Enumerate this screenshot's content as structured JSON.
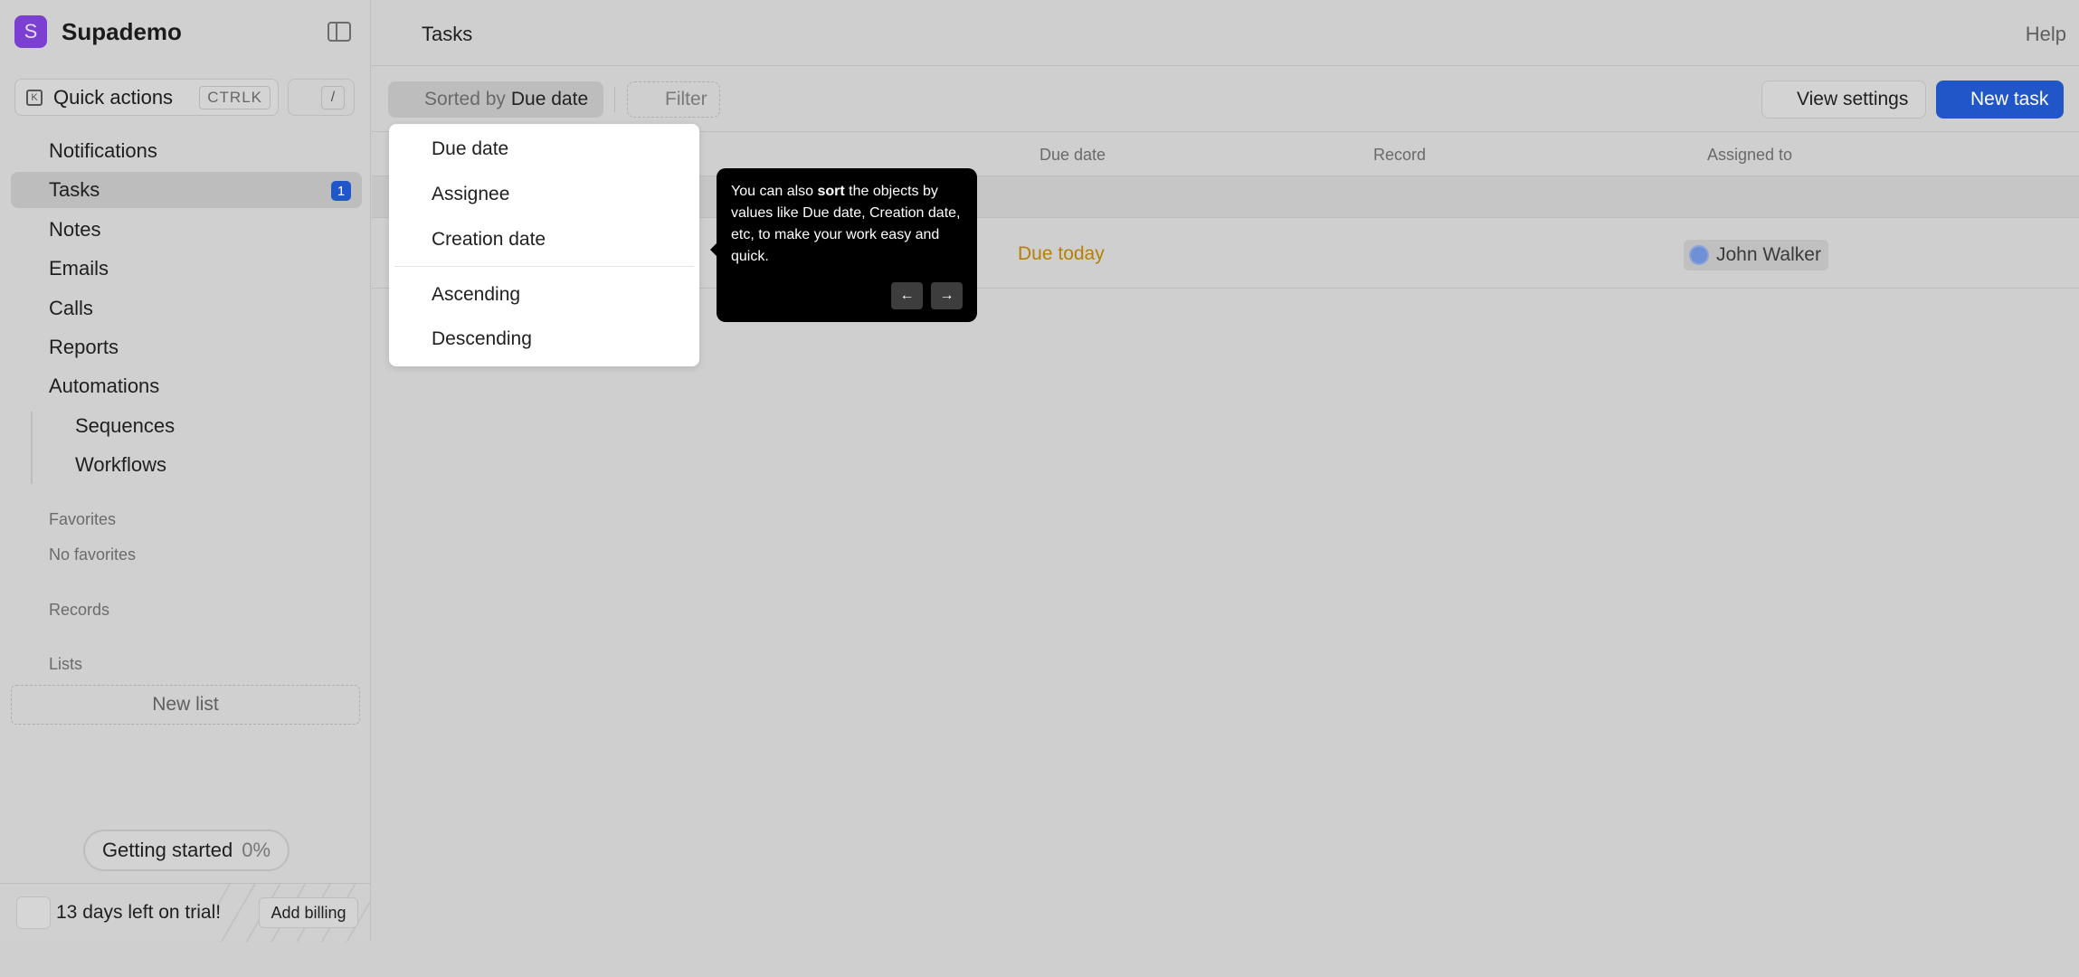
{
  "app": {
    "name": "Supademo",
    "logo_letter": "S"
  },
  "sidebar": {
    "quick_actions": {
      "label": "Quick actions",
      "shortcut": "CTRLK",
      "slash": "/"
    },
    "items": [
      {
        "label": "Notifications"
      },
      {
        "label": "Tasks",
        "badge": "1",
        "active": true
      },
      {
        "label": "Notes"
      },
      {
        "label": "Emails"
      },
      {
        "label": "Calls"
      },
      {
        "label": "Reports"
      },
      {
        "label": "Automations"
      },
      {
        "label": "Sequences"
      },
      {
        "label": "Workflows"
      }
    ],
    "favorites": {
      "heading": "Favorites",
      "empty": "No favorites"
    },
    "records": {
      "heading": "Records"
    },
    "lists": {
      "heading": "Lists",
      "new_list": "New list"
    },
    "getting_started": {
      "label": "Getting started",
      "percent": "0%"
    },
    "trial": {
      "text": "13 days left on trial!",
      "billing": "Add billing"
    }
  },
  "header": {
    "title": "Tasks",
    "help": "Help"
  },
  "toolbar": {
    "sort_prefix": "Sorted by",
    "sort_value": "Due date",
    "filter": "Filter",
    "view_settings": "View settings",
    "new_task": "New task"
  },
  "table": {
    "columns": [
      "Due date",
      "Record",
      "Assigned to"
    ],
    "rows": [
      {
        "due": "Due today",
        "assignee": "John Walker"
      }
    ]
  },
  "sort_menu": {
    "fields": [
      "Due date",
      "Assignee",
      "Creation date"
    ],
    "orders": [
      "Ascending",
      "Descending"
    ]
  },
  "tooltip": {
    "text_before": "You can also ",
    "text_bold": "sort",
    "text_after": " the objects by values like Due date, Creation date, etc, to make your work easy and quick.",
    "prev": "←",
    "next": "→"
  },
  "colors": {
    "accent": "#2156c8",
    "brand": "#7b3fd2",
    "due_today": "#b58105"
  }
}
